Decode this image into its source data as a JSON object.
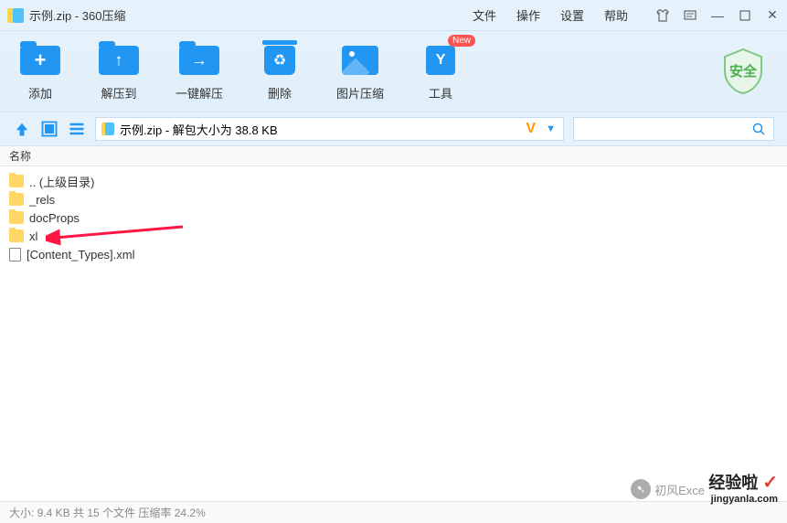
{
  "title": "示例.zip - 360压缩",
  "menu": {
    "file": "文件",
    "operate": "操作",
    "settings": "设置",
    "help": "帮助"
  },
  "toolbar": {
    "add": "添加",
    "extract_to": "解压到",
    "one_click": "一键解压",
    "delete": "删除",
    "img_compress": "图片压缩",
    "tools": "工具",
    "new_badge": "New",
    "safe": "安全"
  },
  "address": "示例.zip - 解包大小为 38.8 KB",
  "columns": {
    "name": "名称"
  },
  "files": {
    "parent": ".. (上级目录)",
    "rels": "_rels",
    "docprops": "docProps",
    "xl": "xl",
    "content_types": "[Content_Types].xml"
  },
  "status": "大小: 9.4 KB 共 15 个文件 压缩率 24.2%",
  "watermarks": {
    "w1": "初风Exce",
    "w2a": "经验啦",
    "w2b": "jingyanla.com"
  }
}
